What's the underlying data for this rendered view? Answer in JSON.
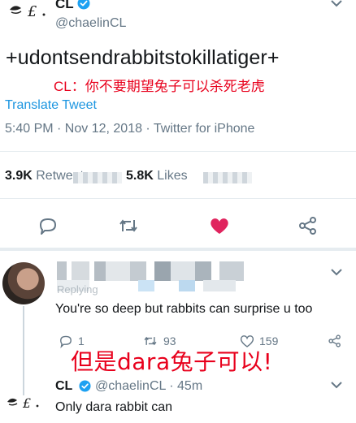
{
  "tweet": {
    "display_name": "CL",
    "handle": "@chaelinCL",
    "text": "+udontsendrabbitstokillatiger+",
    "translation": "CL：你不要期望兔子可以杀死老虎",
    "translate_link": "Translate Tweet",
    "meta": "5:40 PM · Nov 12, 2018 · Twitter for iPhone",
    "retweets_count": "3.9K",
    "retweets_label": "Retweets",
    "likes_count": "5.8K",
    "likes_label": "Likes",
    "icons": [
      "reply-icon",
      "retweet-icon",
      "heart-icon",
      "share-icon"
    ],
    "colors": {
      "heart": "#e0245e",
      "link": "#1b95e0",
      "red_overlay": "#e8001c"
    }
  },
  "reply": {
    "replying_label": "Replying",
    "text": "You're so deep but rabbits can surprise u too",
    "reply_count": "1",
    "retweet_count": "93",
    "like_count": "159",
    "overlay": "但是dara兔子可以!"
  },
  "reply2": {
    "display_name": "CL",
    "handle_time": "@chaelinCL · 45m",
    "text": "Only dara rabbit can"
  }
}
